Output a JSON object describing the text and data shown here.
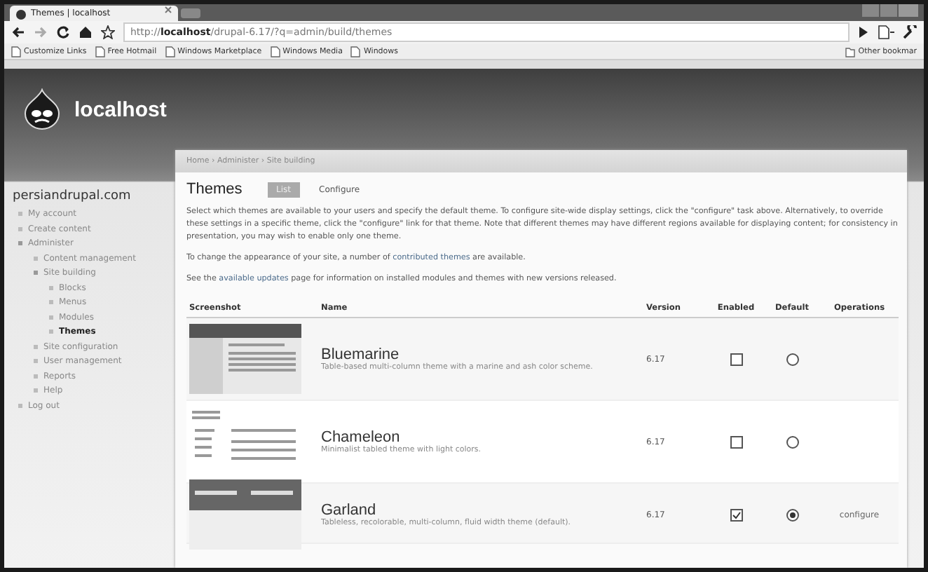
{
  "browser": {
    "tab_title": "Themes | localhost",
    "url": "http://**localhost**/drupal-6.17/?q=admin/build/themes",
    "bookmarks": [
      "Customize Links",
      "Free Hotmail",
      "Windows Marketplace",
      "Windows Media",
      "Windows"
    ],
    "other_bookmarks": "Other bookmar"
  },
  "site": {
    "name": "localhost"
  },
  "sidebar": {
    "title": "persiandrupal.com",
    "items": [
      {
        "label": "My account",
        "selected": false
      },
      {
        "label": "Create content",
        "selected": false
      },
      {
        "label": "Administer",
        "selected": false,
        "children": [
          {
            "label": "Content management",
            "selected": false
          },
          {
            "label": "Site building",
            "selected": false,
            "children": [
              {
                "label": "Blocks",
                "selected": false
              },
              {
                "label": "Menus",
                "selected": false
              },
              {
                "label": "Modules",
                "selected": false
              },
              {
                "label": "Themes",
                "selected": true
              }
            ]
          },
          {
            "label": "Site configuration",
            "selected": false
          },
          {
            "label": "User management",
            "selected": false
          },
          {
            "label": "Reports",
            "selected": false
          },
          {
            "label": "Help",
            "selected": false
          }
        ]
      },
      {
        "label": "Log out",
        "selected": false
      }
    ]
  },
  "breadcrumb": "Home › Administer › Site building",
  "page": {
    "title": "Themes",
    "tabs": [
      {
        "label": "List",
        "selected": true
      },
      {
        "label": "Configure",
        "selected": false
      }
    ],
    "paragraphs": [
      [
        {
          "kind": "text",
          "text": "Select which themes are available to your users and specify the default theme. To configure site-wide display settings, click the \"configure\" task above. Alternatively, to override these settings in a specific theme, click the \"configure\" link for that theme. Note that different themes may have different regions available for displaying content; for consistency in presentation, you may wish to enable only one theme."
        }
      ],
      [
        {
          "kind": "text",
          "text": "To change the appearance of your site, a number of "
        },
        {
          "kind": "link",
          "text": "contributed themes"
        },
        {
          "kind": "text",
          "text": " are available."
        }
      ],
      [
        {
          "kind": "text",
          "text": "See the "
        },
        {
          "kind": "link",
          "text": "available updates"
        },
        {
          "kind": "text",
          "text": " page for information on installed modules and themes with new versions released."
        }
      ]
    ]
  },
  "table": {
    "columns": [
      "Screenshot",
      "Name",
      "Version",
      "Enabled",
      "Default",
      "Operations"
    ],
    "rows": [
      {
        "kind": "bluemarine",
        "name": "Bluemarine",
        "description": "Table-based multi-column theme with a marine and ash color scheme.",
        "version": "6.17",
        "enabled": false,
        "default": false
      },
      {
        "kind": "chameleon",
        "name": "Chameleon",
        "description": "Minimalist tabled theme with light colors.",
        "version": "6.17",
        "enabled": false,
        "default": false
      },
      {
        "kind": "garland",
        "name": "Garland",
        "description": "Tableless, recolorable, multi-column, fluid width theme (default).",
        "version": "6.17",
        "enabled": true,
        "default": true,
        "operation": "configure"
      }
    ]
  }
}
